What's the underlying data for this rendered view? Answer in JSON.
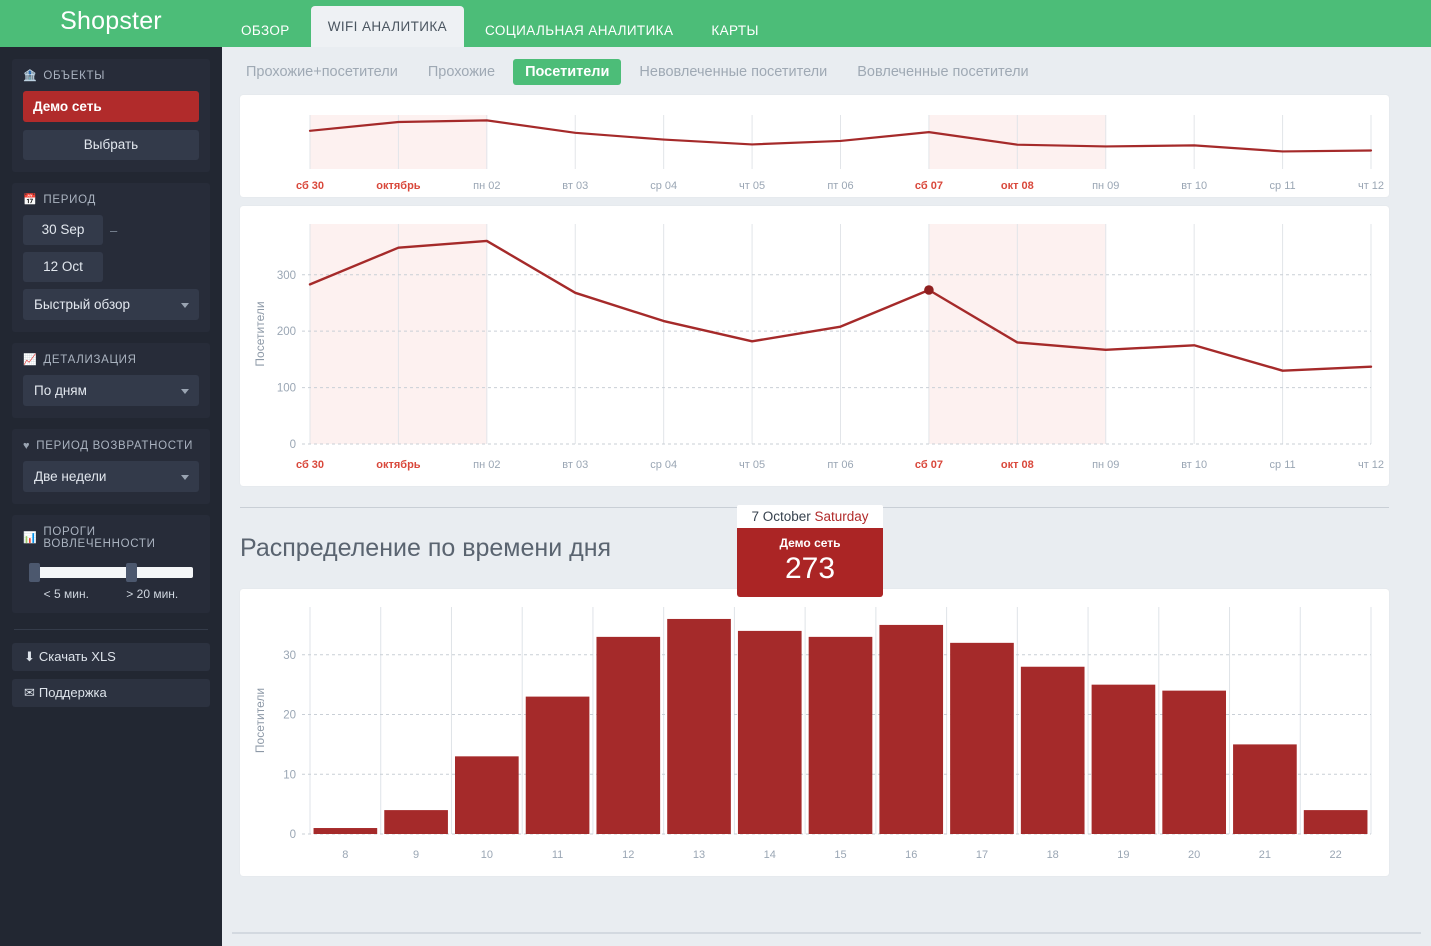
{
  "header": {
    "brand": "Shopster",
    "nav": [
      {
        "label": "ОБЗОР",
        "active": false
      },
      {
        "label": "WIFI АНАЛИТИКА",
        "active": true
      },
      {
        "label": "СОЦИАЛЬНАЯ АНАЛИТИКА",
        "active": false
      },
      {
        "label": "КАРТЫ",
        "active": false
      }
    ]
  },
  "sidebar": {
    "objects": {
      "title": "ОБЪЕКТЫ",
      "icon": "bank-icon",
      "selected": "Демо сеть",
      "choose_label": "Выбрать"
    },
    "period": {
      "title": "ПЕРИОД",
      "icon": "calendar-icon",
      "date_from": "30 Sep",
      "date_to": "12 Oct",
      "separator": "–",
      "quick_select": "Быстрый обзор"
    },
    "detail": {
      "title": "ДЕТАЛИЗАЦИЯ",
      "icon": "chart-line-icon",
      "value": "По дням"
    },
    "return_period": {
      "title": "ПЕРИОД ВОЗВРАТНОСТИ",
      "icon": "heart-icon",
      "value": "Две недели"
    },
    "thresholds": {
      "title": "ПОРОГИ ВОВЛЕЧЕННОСТИ",
      "icon": "bar-chart-icon",
      "left_label": "< 5 мин.",
      "right_label": "> 20 мин.",
      "left_knob_pct": 0,
      "right_knob_pct": 62
    },
    "actions": [
      {
        "label": "Скачать XLS",
        "icon": "download-icon",
        "glyph": "⬇"
      },
      {
        "label": "Поддержка",
        "icon": "envelope-icon",
        "glyph": "✉"
      }
    ]
  },
  "subtabs": [
    {
      "label": "Прохожие+посетители",
      "active": false
    },
    {
      "label": "Прохожие",
      "active": false
    },
    {
      "label": "Посетители",
      "active": true
    },
    {
      "label": "Невовлеченные посетители",
      "active": false
    },
    {
      "label": "Вовлеченные посетители",
      "active": false
    }
  ],
  "section_title": "Распределение по времени дня",
  "tooltip": {
    "date": "7 October",
    "weekday": "Saturday",
    "series_name": "Демо сеть",
    "value": "273"
  },
  "colors": {
    "brand_green": "#4cbd78",
    "accent_red": "#b12b2b",
    "line_red": "#a52a2a",
    "sidebar_bg": "#222732",
    "panel_bg": "#272c39",
    "page_bg": "#e9edf1",
    "weekend_band": "#fdf1f0",
    "weekend_label": "#d9483b"
  },
  "chart_data": [
    {
      "type": "line",
      "name": "navigator",
      "title": "",
      "xlabel": "",
      "ylabel": "",
      "grid": true,
      "categories": [
        "сб 30",
        "октябрь",
        "пн 02",
        "вт 03",
        "ср 04",
        "чт 05",
        "пт 06",
        "сб 07",
        "окт 08",
        "пн 09",
        "вт 10",
        "ср 11",
        "чт 12"
      ],
      "weekend_ticks": [
        "сб 30",
        "октябрь",
        "сб 07",
        "окт 08"
      ],
      "values": [
        283,
        348,
        360,
        268,
        218,
        182,
        208,
        273,
        180,
        167,
        175,
        130,
        137
      ],
      "ylim": [
        0,
        400
      ],
      "highlight_bands": [
        [
          0,
          2
        ],
        [
          7,
          9
        ]
      ]
    },
    {
      "type": "line",
      "name": "visitors-by-day",
      "title": "",
      "xlabel": "",
      "ylabel": "Посетители",
      "grid": true,
      "categories": [
        "сб 30",
        "октябрь",
        "пн 02",
        "вт 03",
        "ср 04",
        "чт 05",
        "пт 06",
        "сб 07",
        "окт 08",
        "пн 09",
        "вт 10",
        "ср 11",
        "чт 12"
      ],
      "weekend_ticks": [
        "сб 30",
        "октябрь",
        "сб 07",
        "окт 08"
      ],
      "values": [
        283,
        348,
        360,
        268,
        218,
        182,
        208,
        273,
        180,
        167,
        175,
        130,
        137
      ],
      "yticks": [
        0,
        100,
        200,
        300
      ],
      "ylim": [
        0,
        390
      ],
      "highlight_bands": [
        [
          0,
          2
        ],
        [
          7,
          9
        ]
      ],
      "marked_point": {
        "category": "сб 07",
        "value": 273
      }
    },
    {
      "type": "bar",
      "name": "distribution-by-hour",
      "title": "Распределение по времени дня",
      "xlabel": "",
      "ylabel": "Посетители",
      "grid": true,
      "categories": [
        "8",
        "9",
        "10",
        "11",
        "12",
        "13",
        "14",
        "15",
        "16",
        "17",
        "18",
        "19",
        "20",
        "21",
        "22"
      ],
      "values": [
        1,
        4,
        13,
        23,
        33,
        36,
        34,
        33,
        35,
        32,
        28,
        25,
        24,
        15,
        4
      ],
      "yticks": [
        0,
        10,
        20,
        30
      ],
      "ylim": [
        0,
        38
      ]
    }
  ]
}
